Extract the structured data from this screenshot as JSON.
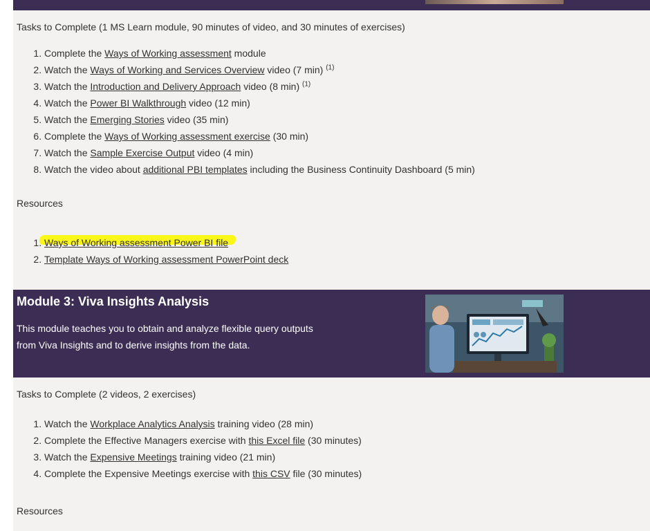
{
  "module2": {
    "tasks_heading": "Tasks to Complete (1 MS Learn module, 90 minutes of video, and 30 minutes of exercises)",
    "tasks": [
      {
        "pre": "Complete the ",
        "link": "Ways of Working assessment",
        "post": " module",
        "sup": ""
      },
      {
        "pre": "Watch the ",
        "link": "Ways of Working and Services Overview",
        "post": " video (7 min) ",
        "sup": "(1)"
      },
      {
        "pre": "Watch the ",
        "link": "Introduction and Delivery Approach",
        "post": " video (8 min) ",
        "sup": "(1)"
      },
      {
        "pre": "Watch the ",
        "link": "Power BI Walkthrough",
        "post": " video (12 min)",
        "sup": ""
      },
      {
        "pre": "Watch the ",
        "link": "Emerging Stories",
        "post": " video (35 min)",
        "sup": ""
      },
      {
        "pre": "Complete the ",
        "link": "Ways of Working assessment exercise",
        "post": " (30 min)",
        "sup": ""
      },
      {
        "pre": "Watch the ",
        "link": "Sample Exercise Output",
        "post": " video (4 min)",
        "sup": ""
      },
      {
        "pre": "Watch the video about ",
        "link": "additional PBI templates",
        "post": " including the Business Continuity Dashboard (5 min)",
        "sup": ""
      }
    ],
    "resources_heading": "Resources",
    "resources": [
      {
        "link": "Ways of Working assessment Power BI file"
      },
      {
        "link": "Template Ways of Working assessment PowerPoint deck"
      }
    ]
  },
  "module3": {
    "title": "Module 3: Viva Insights Analysis",
    "description": "This module teaches you to obtain and analyze flexible query outputs from Viva Insights and to derive insights from the data.",
    "tasks_heading": "Tasks to Complete (2 videos, 2 exercises)",
    "tasks": [
      {
        "pre": "Watch the ",
        "link": "Workplace Analytics Analysis",
        "post": " training video (28 min)"
      },
      {
        "pre": "Complete the Effective Managers exercise with ",
        "link": "this Excel file",
        "post": " (30 minutes)"
      },
      {
        "pre": "Watch the ",
        "link": "Expensive Meetings",
        "post": " training video (21 min)"
      },
      {
        "pre": "Complete the Expensive Meetings exercise with ",
        "link": "this CSV",
        "post": " file (30 minutes)"
      }
    ],
    "resources_heading": "Resources"
  },
  "colors": {
    "band": "#3b2d54",
    "page": "#f3f2f1",
    "text": "#323130",
    "highlight": "#fbf718"
  }
}
